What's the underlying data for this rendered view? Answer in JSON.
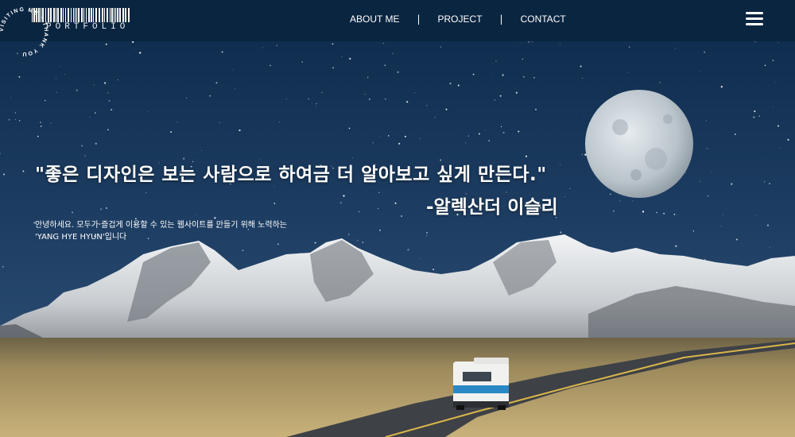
{
  "header": {
    "logo_circle_text": "VISITING ME · THANK YOU ·",
    "logo_text": "PORTFOLIO",
    "nav": [
      {
        "label": "ABOUT ME"
      },
      {
        "label": "PROJECT"
      },
      {
        "label": "CONTACT"
      }
    ],
    "separator": "|"
  },
  "hero": {
    "quote": "\"좋은 디자인은 보는 사람으로 하여금 더 알아보고 싶게 만든다.\"",
    "author": "-알렉산더 이슬리",
    "intro_line1": "안녕하세요. 모두가 즐겁게 이용할 수 있는 웹사이트를 만들기 위해 노력하는",
    "intro_line2": "'YANG HYE HYUN'입니다"
  },
  "colors": {
    "header_bg": "#0a2540",
    "sky_top": "#0b2340",
    "sky_bottom": "#2a4a6e",
    "text": "#ffffff"
  }
}
